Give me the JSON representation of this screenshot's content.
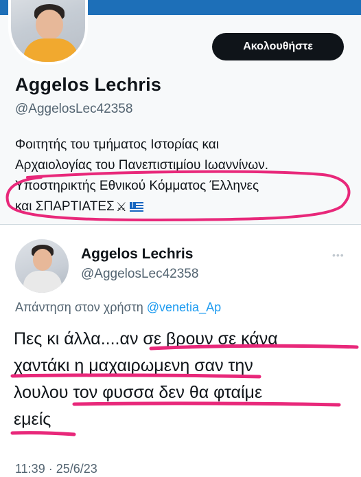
{
  "header": {
    "follow_label": "Ακολουθήστε"
  },
  "profile": {
    "name": "Aggelos Lechris",
    "handle": "@AggelosLec42358",
    "bio_lines": [
      "Φοιτητής του τμήματος Ιστορίας και",
      "Αρχαιολογίας του Πανεπιστιμίου Ιωαννίνων.",
      "Υποστηρικτής Εθνικού Κόμματος Έλληνες",
      "και ΣΠΑΡΤΙΑΤΕΣ"
    ]
  },
  "tweet": {
    "name": "Aggelos Lechris",
    "handle": "@AggelosLec42358",
    "reply_prefix": "Απάντηση στον χρήστη",
    "reply_mention": "@venetia_Ap",
    "text_lines": [
      "Πες κι άλλα....αν σε βρουν σε κάνα",
      "χαντάκι η μαχαιρωμενη σαν την",
      "λουλου τον φυσσα δεν θα φταίμε",
      "εμείς"
    ],
    "timestamp": "11:39 · 25/6/23"
  },
  "colors": {
    "accent": "#1d9bf0",
    "highlight": "#e8287a",
    "button": "#0f1419"
  },
  "icons": {
    "more": "more-dots-icon",
    "swords": "crossed-swords-icon",
    "flag": "greek-flag-icon"
  }
}
